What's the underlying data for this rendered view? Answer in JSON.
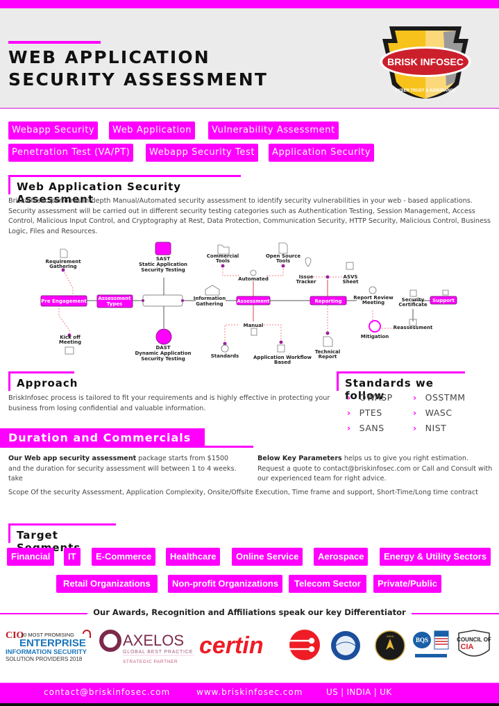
{
  "header": {
    "title_line1": "WEB APPLICATION",
    "title_line2": "SECURITY ASSESSMENT",
    "logo": {
      "name": "BRISK INFOSEC",
      "tagline": "CYBER TRUST & ASSURANCE"
    }
  },
  "tags": [
    "Webapp Security",
    "Web Application",
    "Vulnerability Assessment",
    "Penetration Test (VA/PT)",
    "Webapp Security Test",
    "Application Security"
  ],
  "intro": {
    "heading": "Web Application Security Assessment",
    "body": "Briskinfosec performs in-depth Manual/Automated security assessment to identify security vulnerabilities in your web - based applications. Security assessment will be carried out in different security testing categories such as Authentication Testing, Session Management, Access Control, Malicious Input Control, and Cryptography at Rest, Data Protection, Communication Security, HTTP Security, Malicious Control, Business Logic, Files and Resources."
  },
  "diagram": {
    "boxes": {
      "pre_engagement": "Pre Engagement",
      "assessment_types_1": "Assessment",
      "assessment_types_2": "Types",
      "assessment": "Assessment",
      "reporting": "Reporting",
      "support": "Support"
    },
    "labels": {
      "requirement_1": "Requirement",
      "requirement_2": "Gathering",
      "kickoff_1": "Kick off",
      "kickoff_2": "Meeting",
      "sast": "SAST",
      "sast_1": "Static Application",
      "sast_2": "Security Testing",
      "dast": "DAST",
      "dast_1": "Dynamic Application",
      "dast_2": "Security Testing",
      "info_1": "Information",
      "info_2": "Gathering",
      "commercial_1": "Commercial",
      "commercial_2": "Tools",
      "opensource_1": "Open Source",
      "opensource_2": "Tools",
      "automated": "Automated",
      "manual": "Manual",
      "standards": "Standards",
      "workflow_1": "Application Workflow",
      "workflow_2": "Based",
      "issue_1": "Issue",
      "issue_2": "Tracker",
      "asvs_1": "ASVS",
      "asvs_2": "Sheet",
      "technical_1": "Technical",
      "technical_2": "Report",
      "review_1": "Report Review",
      "review_2": "Meeting",
      "mitigation": "Mitigation",
      "reassessment": "Reassessment",
      "certificate_1": "Security",
      "certificate_2": "Certificate"
    }
  },
  "approach": {
    "heading": "Approach",
    "body": "BriskInfosec process is tailored to fit your requirements and is highly effective in protecting your business from losing confidential and valuable information."
  },
  "standards": {
    "heading": "Standards we follow",
    "items": [
      "OWASP",
      "OSSTMM",
      "PTES",
      "WASC",
      "SANS",
      "NIST"
    ]
  },
  "duration": {
    "heading": "Duration and Commercials",
    "left_bold": "Our Web app security assessment",
    "left_rest": " package starts from $1500 and the duration for security assessment will between 1 to 4 weeks. take",
    "right_bold": "Below Key Parameters",
    "right_rest": " helps us to give you right estimation. Request a quote to contact@briskinfosec.com or Call and Consult with our experienced team for right advice.",
    "scope": "Scope Of the security Assessment, Application Complexity, Onsite/Offsite Execution, Time frame and support, Short-Time/Long time contract"
  },
  "segments": {
    "heading": "Target Segments",
    "row1": [
      "Financial",
      "IT",
      "E-Commerce",
      "Healthcare",
      "Online Service",
      "Aerospace",
      "Energy & Utility Sectors"
    ],
    "row2": [
      "Retail Organizations",
      "Non-profit Organizations",
      "Telecom Sector",
      "Private/Public"
    ]
  },
  "awards": {
    "heading": "Our Awards, Recognition and Affiliations speak our key Differentiator",
    "cio_1": "20 MOST PROMISING",
    "cio_2": "ENTERPRISE",
    "cio_3": "INFORMATION SECURITY",
    "cio_4": "SOLUTION PROVIDERS 2018",
    "axelos": "AXELOS",
    "axelos_sub": "GLOBAL BEST PRACTICE",
    "axelos_partner": "STRATEGIC PARTNER",
    "certin": "certin",
    "india_book": "INDIA BOOK OF RECORDS",
    "bqs": "BQS",
    "council_1": "COUNCIL OF",
    "council_2": "CIA"
  },
  "footer": {
    "email": "contact@briskinfosec.com",
    "website": "www.briskinfosec.com",
    "regions": "US | INDIA | UK"
  },
  "colors": {
    "accent": "#ff00ff",
    "header_bg": "#ebebeb",
    "logo_red": "#cc1f2c",
    "logo_yellow": "#f7c21b"
  }
}
